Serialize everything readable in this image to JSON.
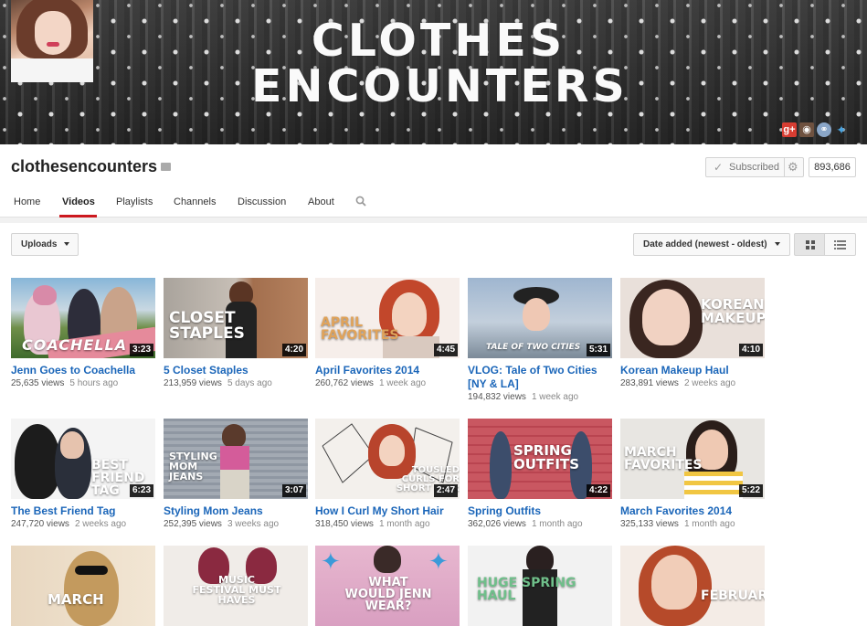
{
  "banner": {
    "title_line1": "CLOTHES",
    "title_line2": "ENCOUNTERS"
  },
  "social_icons": [
    "google-plus-icon",
    "instagram-icon",
    "globe-icon",
    "twitter-icon"
  ],
  "channel": {
    "name": "clothesencounters",
    "subscribe_label": "Subscribed",
    "subscriber_count": "893,686"
  },
  "tabs": [
    "Home",
    "Videos",
    "Playlists",
    "Channels",
    "Discussion",
    "About"
  ],
  "active_tab": "Videos",
  "filters": {
    "uploads_label": "Uploads",
    "sort_label": "Date added (newest - oldest)"
  },
  "videos": [
    {
      "title": "Jenn Goes to Coachella",
      "views": "25,635 views",
      "ago": "5 hours ago",
      "duration": "3:23",
      "overlay": "COACHELLA"
    },
    {
      "title": "5 Closet Staples",
      "views": "213,959 views",
      "ago": "5 days ago",
      "duration": "4:20",
      "overlay": "CLOSET STAPLES"
    },
    {
      "title": "April Favorites 2014",
      "views": "260,762 views",
      "ago": "1 week ago",
      "duration": "4:45",
      "overlay": "APRIL FAVORITES"
    },
    {
      "title": "VLOG: Tale of Two Cities [NY & LA]",
      "views": "194,832 views",
      "ago": "1 week ago",
      "duration": "5:31",
      "overlay": "TALE OF TWO CITIES"
    },
    {
      "title": "Korean Makeup Haul",
      "views": "283,891 views",
      "ago": "2 weeks ago",
      "duration": "4:10",
      "overlay": "KOREAN MAKEUP"
    },
    {
      "title": "The Best Friend Tag",
      "views": "247,720 views",
      "ago": "2 weeks ago",
      "duration": "6:23",
      "overlay": "BEST FRIEND TAG"
    },
    {
      "title": "Styling Mom Jeans",
      "views": "252,395 views",
      "ago": "3 weeks ago",
      "duration": "3:07",
      "overlay": "STYLING MOM JEANS"
    },
    {
      "title": "How I Curl My Short Hair",
      "views": "318,450 views",
      "ago": "1 month ago",
      "duration": "2:47",
      "overlay": "TOUSLED CURLS FOR SHORT HAIR"
    },
    {
      "title": "Spring Outfits",
      "views": "362,026 views",
      "ago": "1 month ago",
      "duration": "4:22",
      "overlay": "SPRING OUTFITS"
    },
    {
      "title": "March Favorites 2014",
      "views": "325,133 views",
      "ago": "1 month ago",
      "duration": "5:22",
      "overlay": "MARCH FAVORITES"
    },
    {
      "overlay": "MARCH"
    },
    {
      "overlay": "MUSIC FESTIVAL MUST HAVES"
    },
    {
      "overlay": "WHAT WOULD JENN WEAR?"
    },
    {
      "overlay": "HUGE SPRING HAUL"
    },
    {
      "overlay": "FEBRUARY"
    }
  ]
}
